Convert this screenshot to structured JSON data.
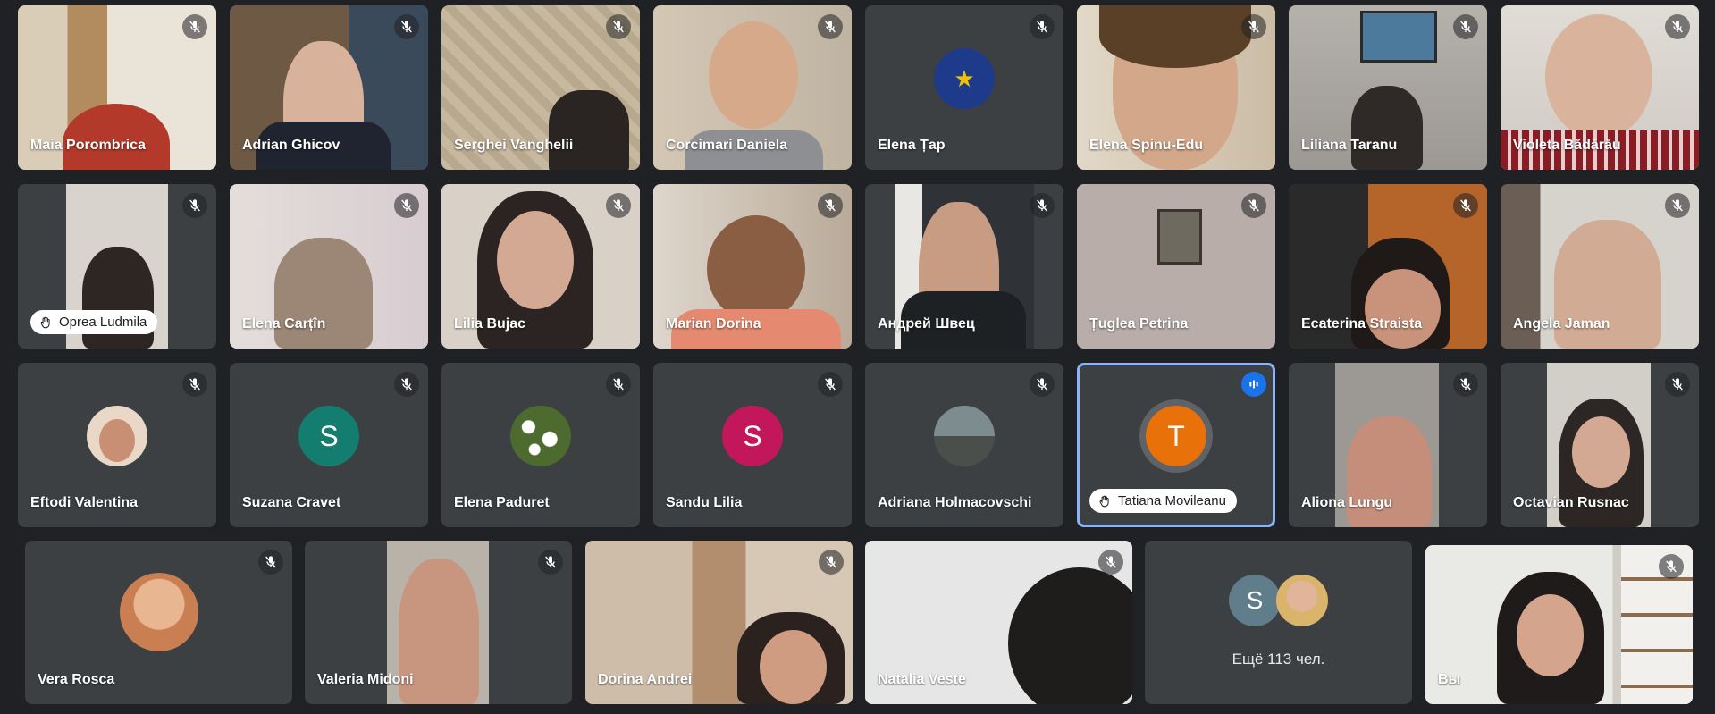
{
  "meeting": {
    "more_participants": "Ещё 113 чел.",
    "more_initial": "S"
  },
  "row1": [
    {
      "name": "Maia Porombrica",
      "bg": "#c7b79c"
    },
    {
      "name": "Adrian Ghicov",
      "bg": "#8a7a63"
    },
    {
      "name": "Serghei Vanghelii",
      "bg": "#b9a98f"
    },
    {
      "name": "Corcimari Daniela",
      "bg": "#c9bba6"
    },
    {
      "name": "Elena Țap"
    },
    {
      "name": "Elena Spinu-Edu",
      "bg": "#cfc2ad"
    },
    {
      "name": "Liliana Taranu",
      "bg": "#a8a39c"
    },
    {
      "name": "Violeta Bădărău",
      "bg": "#d6d1ca"
    }
  ],
  "row2": [
    {
      "name": "Oprea Ludmila",
      "bg": "#d8d3cc"
    },
    {
      "name": "Elena Carțîn",
      "bg": "#ddd6d4"
    },
    {
      "name": "Lilia Bujac",
      "bg": "#d9d0c8"
    },
    {
      "name": "Marian Dorina",
      "bg": "#c3b5a6"
    },
    {
      "name": "Андрей Швец",
      "bg": "#2f3236"
    },
    {
      "name": "Țuglea Petrina",
      "bg": "#b8ada8"
    },
    {
      "name": "Ecaterina Straista",
      "bg": "#b5652a"
    },
    {
      "name": "Angela Jaman",
      "bg": "#c8c2bd"
    }
  ],
  "row3": [
    {
      "name": "Eftodi Valentina",
      "avatar_color": "#e9d8c8"
    },
    {
      "name": "Suzana Cravet",
      "initial": "S",
      "avatar_color": "#137d70"
    },
    {
      "name": "Elena Paduret",
      "avatar_color": "#4d6b2f"
    },
    {
      "name": "Sandu Lilia",
      "initial": "S",
      "avatar_color": "#c2185b"
    },
    {
      "name": "Adriana Holmacovschi",
      "avatar_color": "#5e6f74"
    },
    {
      "name": "Tatiana Movileanu",
      "initial": "T",
      "avatar_color": "#e8710a"
    },
    {
      "name": "Aliona Lungu",
      "bg": "#9c9893"
    },
    {
      "name": "Octavian Rusnac",
      "bg": "#d2cfc9"
    }
  ],
  "row4": [
    {
      "name": "Vera Rosca",
      "avatar_color": "#d9a07a"
    },
    {
      "name": "Valeria Midoni",
      "bg": "#b8b2a9"
    },
    {
      "name": "Dorina Andrei",
      "bg": "#c9b8a5"
    },
    {
      "name": "Natalia Veste",
      "bg": "#e6e6e6"
    },
    {
      "name": "Вы",
      "bg": "#e9e9e6"
    }
  ],
  "icons": {
    "mute": "mic-off-icon",
    "hand": "raised-hand-icon",
    "speaking": "speaking-indicator-icon"
  },
  "colors": {
    "background": "#202124",
    "tile": "#3c4043",
    "active_border": "#8ab4f8",
    "speaking": "#1a73e8"
  }
}
